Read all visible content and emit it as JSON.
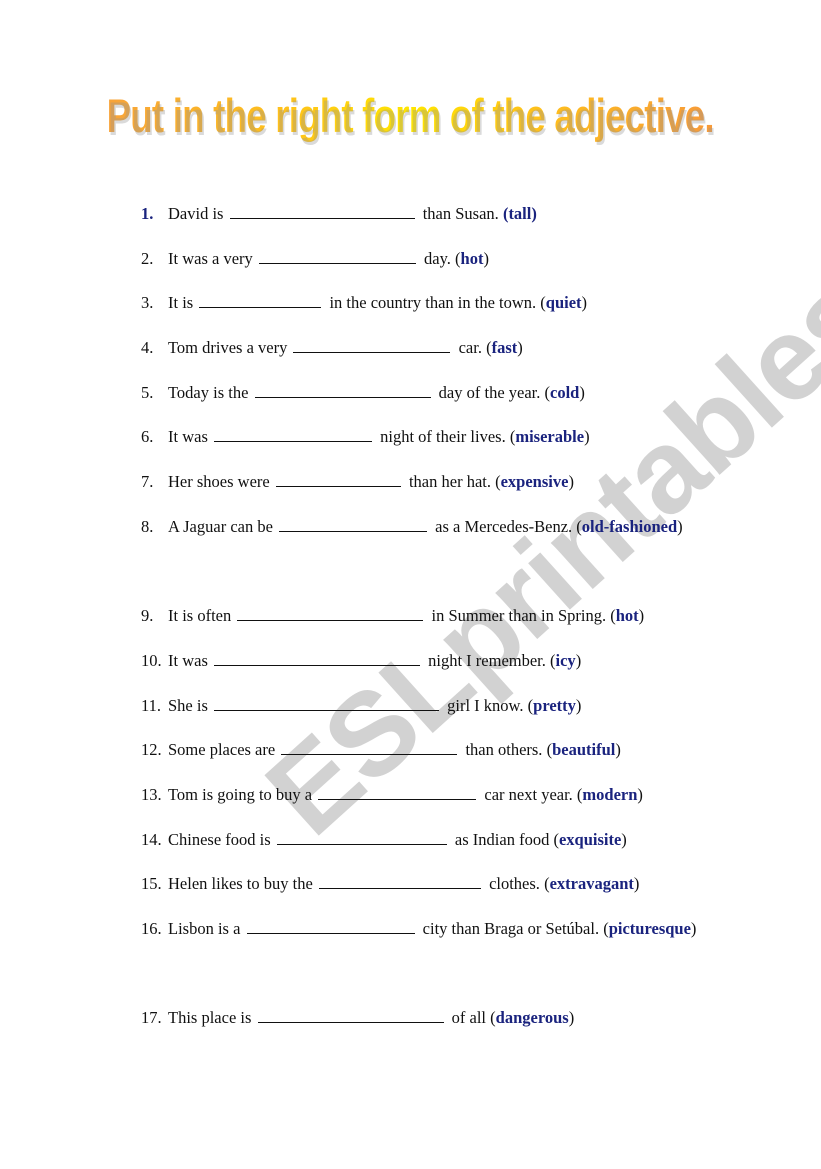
{
  "title": "Put in the right form of the adjective.",
  "watermark": "ESLprintables.com",
  "colors": {
    "hint": "#1a237e",
    "title_gradient": [
      "#f7a33a",
      "#ffe600",
      "#f79a3a"
    ],
    "watermark": "#d2d2d2"
  },
  "items": [
    {
      "number": "1.",
      "before": "David is",
      "after": "than Susan.",
      "hint": "tall"
    },
    {
      "number": "2.",
      "before": "It was a very",
      "after": "day.",
      "hint": "hot"
    },
    {
      "number": "3.",
      "before": "It is",
      "after": "in the country than in the town.",
      "hint": "quiet"
    },
    {
      "number": "4.",
      "before": "Tom drives a very",
      "after": "car.",
      "hint": "fast"
    },
    {
      "number": "5.",
      "before": "Today is the",
      "after": "day of the year.",
      "hint": "cold"
    },
    {
      "number": "6.",
      "before": "It was",
      "after": "night of their lives.",
      "hint": "miserable"
    },
    {
      "number": "7.",
      "before": "Her shoes were",
      "after": "than her hat.",
      "hint": "expensive"
    },
    {
      "number": "8.",
      "before": "A Jaguar can be",
      "after": "as a Mercedes-Benz.",
      "hint": "old-fashioned"
    },
    {
      "number": "9.",
      "before": "It is often",
      "after": "in Summer than in Spring.",
      "hint": "hot"
    },
    {
      "number": "10.",
      "before": "It was",
      "after": "night I remember.",
      "hint": "icy"
    },
    {
      "number": "11.",
      "before": "She is",
      "after": "girl I know.",
      "hint": "pretty"
    },
    {
      "number": "12.",
      "before": "Some places are",
      "after": "than others.",
      "hint": "beautiful"
    },
    {
      "number": "13.",
      "before": "Tom is going to buy a",
      "after": "car next year.",
      "hint": "modern"
    },
    {
      "number": "14.",
      "before": "Chinese food is",
      "after": "as Indian food",
      "hint": "exquisite"
    },
    {
      "number": "15.",
      "before": "Helen likes to buy the",
      "after": "clothes.",
      "hint": "extravagant"
    },
    {
      "number": "16.",
      "before": "Lisbon is a",
      "after": "city than Braga or Setúbal.",
      "hint": "picturesque"
    },
    {
      "number": "17.",
      "before": "This place is",
      "after": "of all",
      "hint": "dangerous"
    }
  ]
}
